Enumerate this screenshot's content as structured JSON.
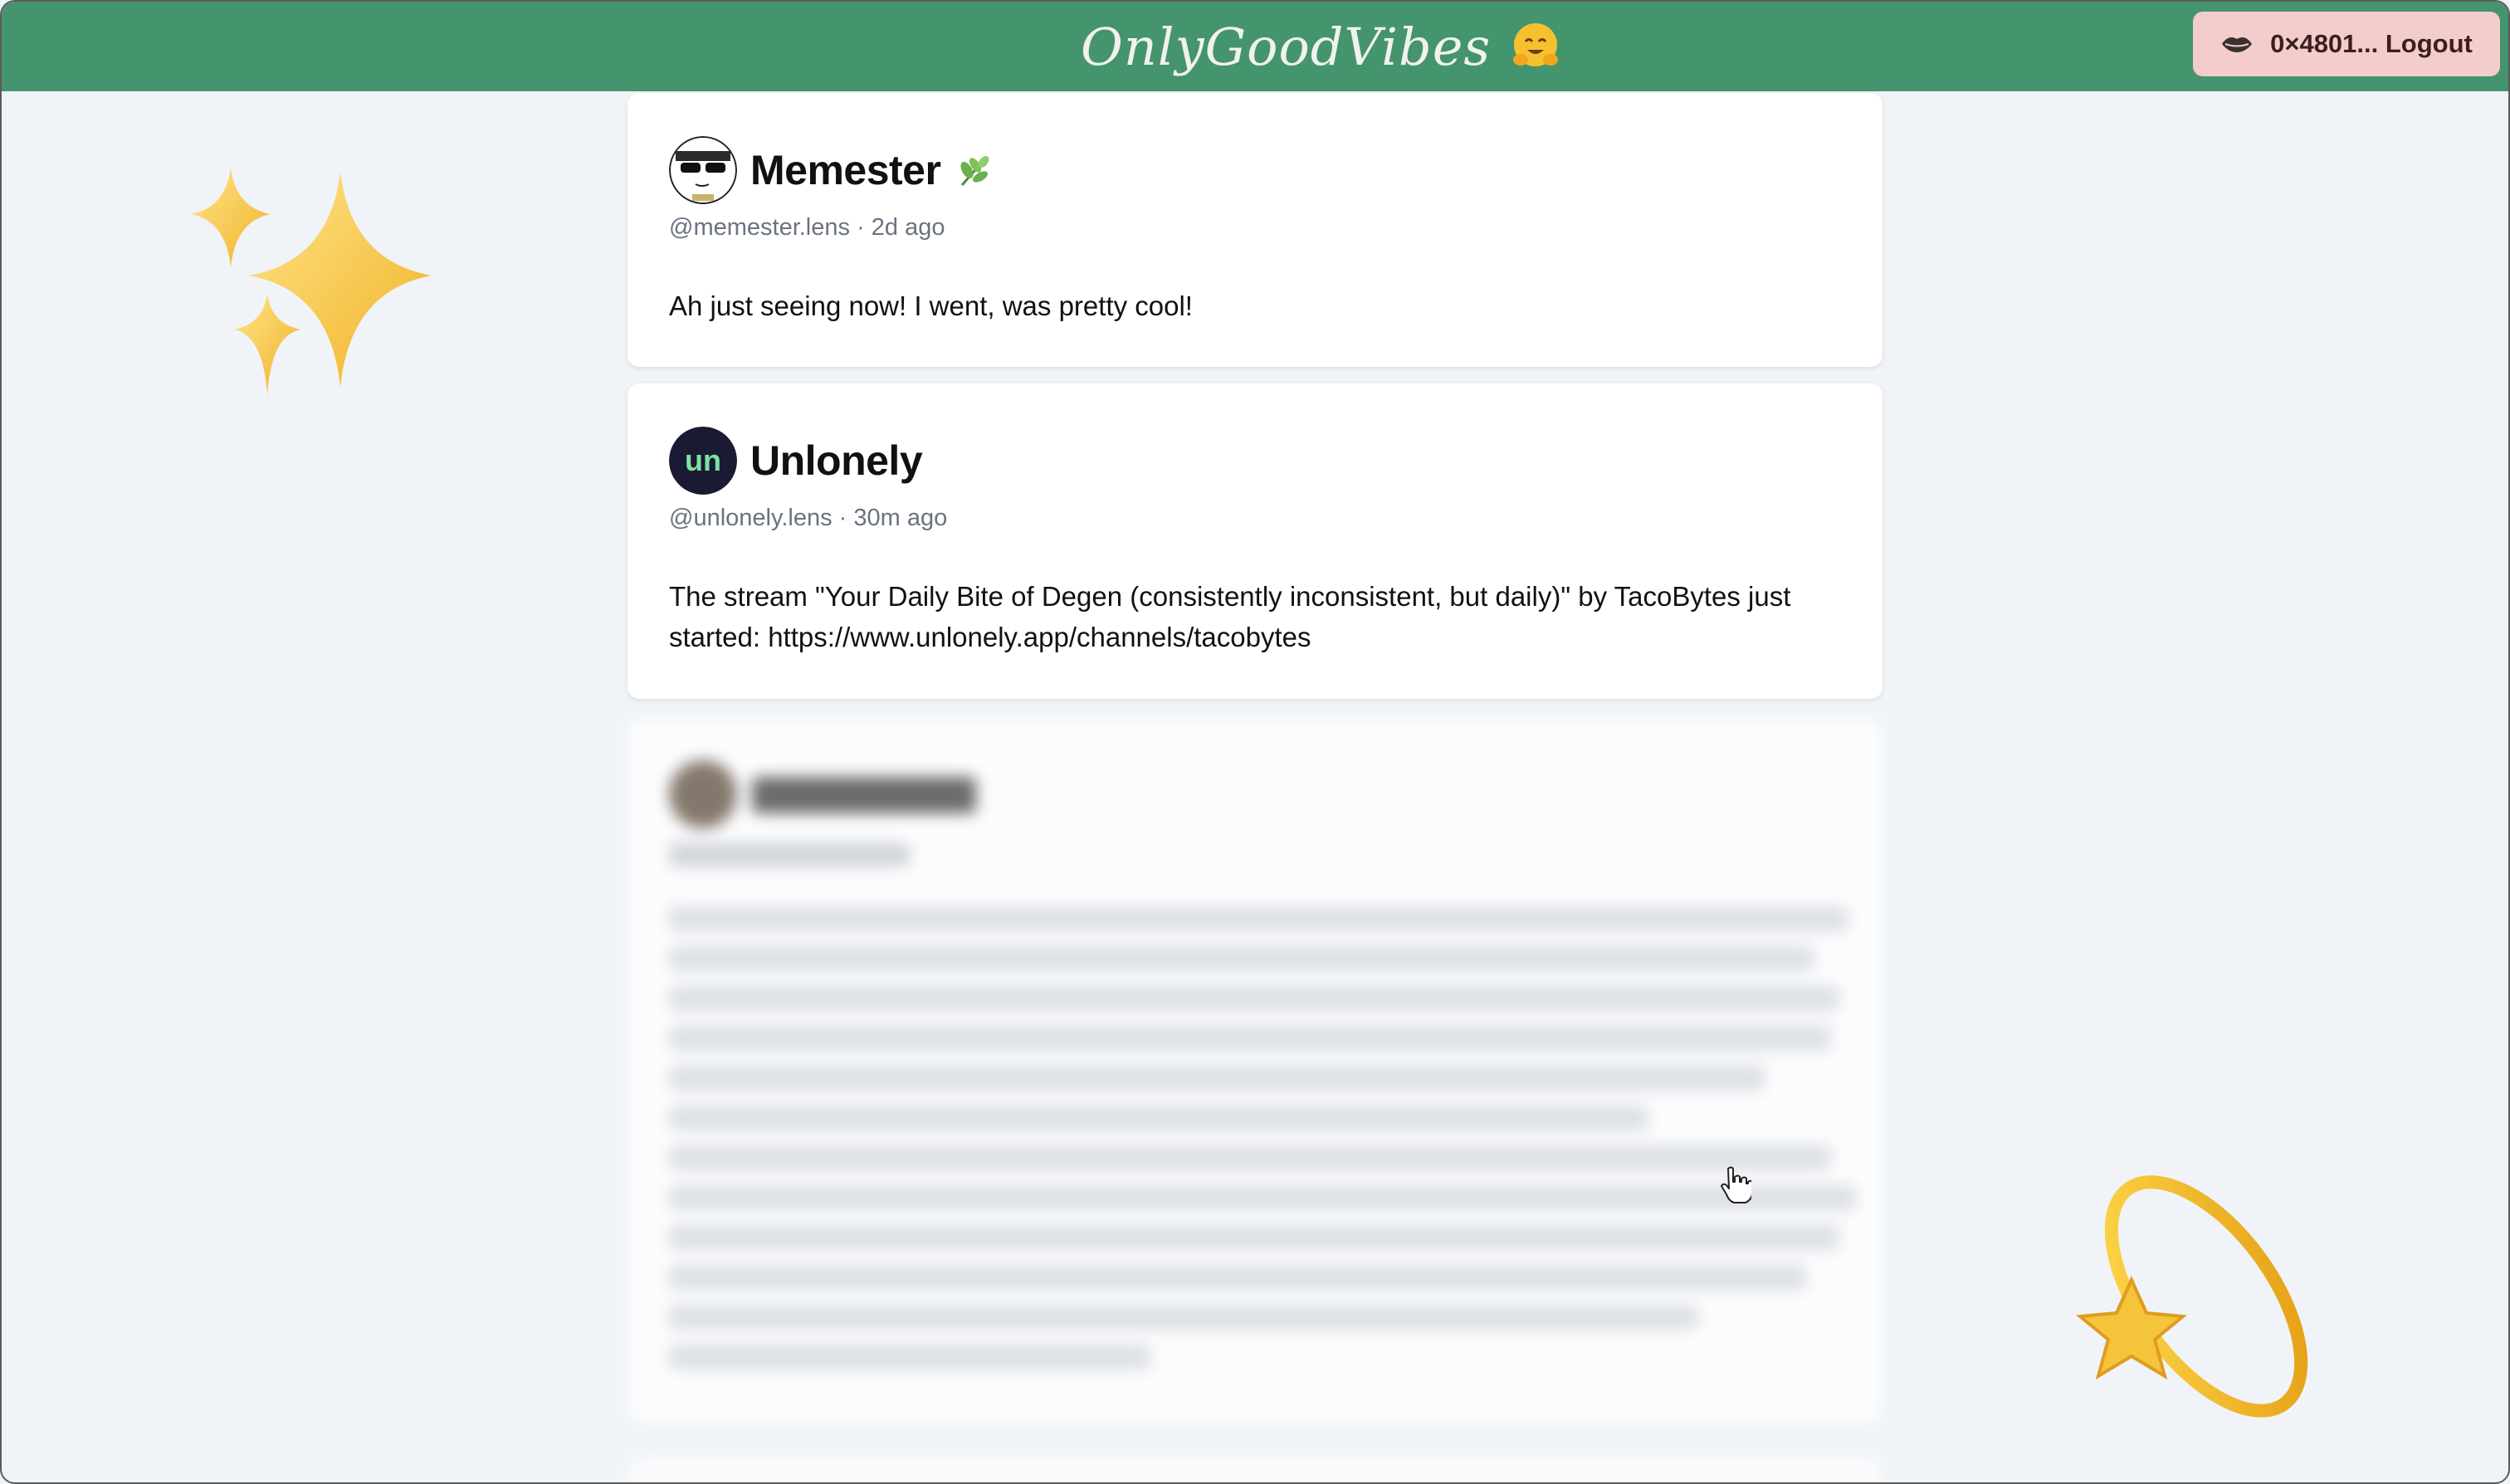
{
  "app": {
    "logo_text": "OnlyGoodVibes",
    "logo_emoji_icon": "hugging-face-emoji",
    "account_icon": "lips-icon",
    "account_label": "0×4801... Logout"
  },
  "posts": [
    {
      "author_name": "Memester",
      "author_badge_icon": "herb-icon",
      "handle": "@memester.lens",
      "time": "2d ago",
      "meta": "@memester.lens · 2d ago",
      "text": "Ah just seeing now! I went, was pretty cool!"
    },
    {
      "author_name": "Unlonely",
      "handle": "@unlonely.lens",
      "time": "30m ago",
      "meta": "@unlonely.lens · 30m ago",
      "text": "The stream \"Your Daily Bite of Degen (consistently inconsistent, but daily)\" by TacoBytes just started: https://www.unlonely.app/channels/tacobytes"
    }
  ],
  "decorations": [
    "sparkles-icon",
    "dizzy-star-icon"
  ],
  "colors": {
    "header": "#44946e",
    "background": "#f0f4f8",
    "account_button": "#f3cccc",
    "card": "#ffffff"
  }
}
